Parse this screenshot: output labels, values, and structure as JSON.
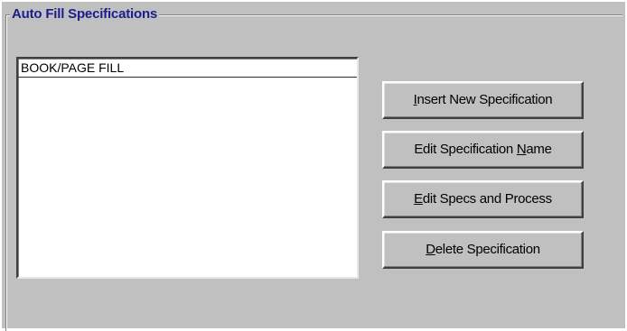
{
  "group": {
    "title": "Auto Fill Specifications"
  },
  "list": {
    "items": [
      "BOOK/PAGE FILL"
    ]
  },
  "buttons": {
    "insert": {
      "mnemonic": "I",
      "rest": "nsert New Specification"
    },
    "edit_name": {
      "before": "Edit Specification ",
      "mnemonic": "N",
      "after": "ame"
    },
    "edit_specs": {
      "mnemonic": "E",
      "rest": "dit Specs and Process"
    },
    "delete": {
      "mnemonic": "D",
      "rest": "elete Specification"
    }
  },
  "colors": {
    "face": "#c0c0c0",
    "title_text": "#1c1c8c"
  }
}
